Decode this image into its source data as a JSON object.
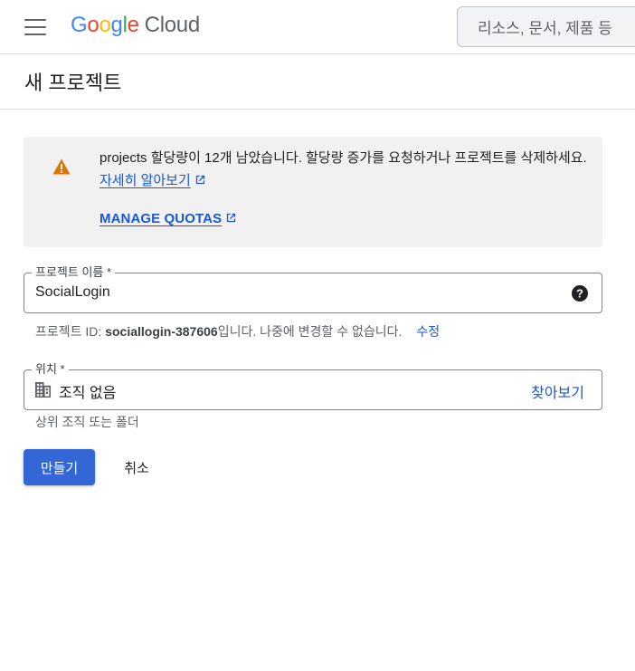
{
  "header": {
    "logo_google": [
      "G",
      "o",
      "o",
      "g",
      "l",
      "e"
    ],
    "logo_google_colors": [
      "#4285F4",
      "#EA4335",
      "#FBBC05",
      "#4285F4",
      "#34A853",
      "#EA4335"
    ],
    "logo_cloud": "Cloud",
    "menu_icon": "hamburger-menu-icon",
    "search_placeholder": "리소스, 문서, 제품 등"
  },
  "page": {
    "title": "새 프로젝트"
  },
  "alert": {
    "icon": "warning-triangle-icon",
    "icon_color": "#e37400",
    "message": "projects 할당량이 12개 남았습니다. 할당량 증가를 요청하거나 프로젝트를 삭제하세요.",
    "learn_more": "자세히 알아보기",
    "manage_quotas": "MANAGE QUOTAS"
  },
  "project_name": {
    "label": "프로젝트 이름 *",
    "value": "SocialLogin",
    "help_icon": "help-circle-icon"
  },
  "project_id_hint": {
    "prefix": "프로젝트 ID: ",
    "id": "sociallogin-387606",
    "suffix": "입니다. 나중에 변경할 수 없습니다.",
    "edit": "수정"
  },
  "location": {
    "label": "위치 *",
    "icon": "building-icon",
    "value": "조직 없음",
    "browse": "찾아보기",
    "hint": "상위 조직 또는 폴더"
  },
  "actions": {
    "create": "만들기",
    "cancel": "취소"
  },
  "colors": {
    "accent": "#1a56d6",
    "primary_button": "#3367d6"
  }
}
